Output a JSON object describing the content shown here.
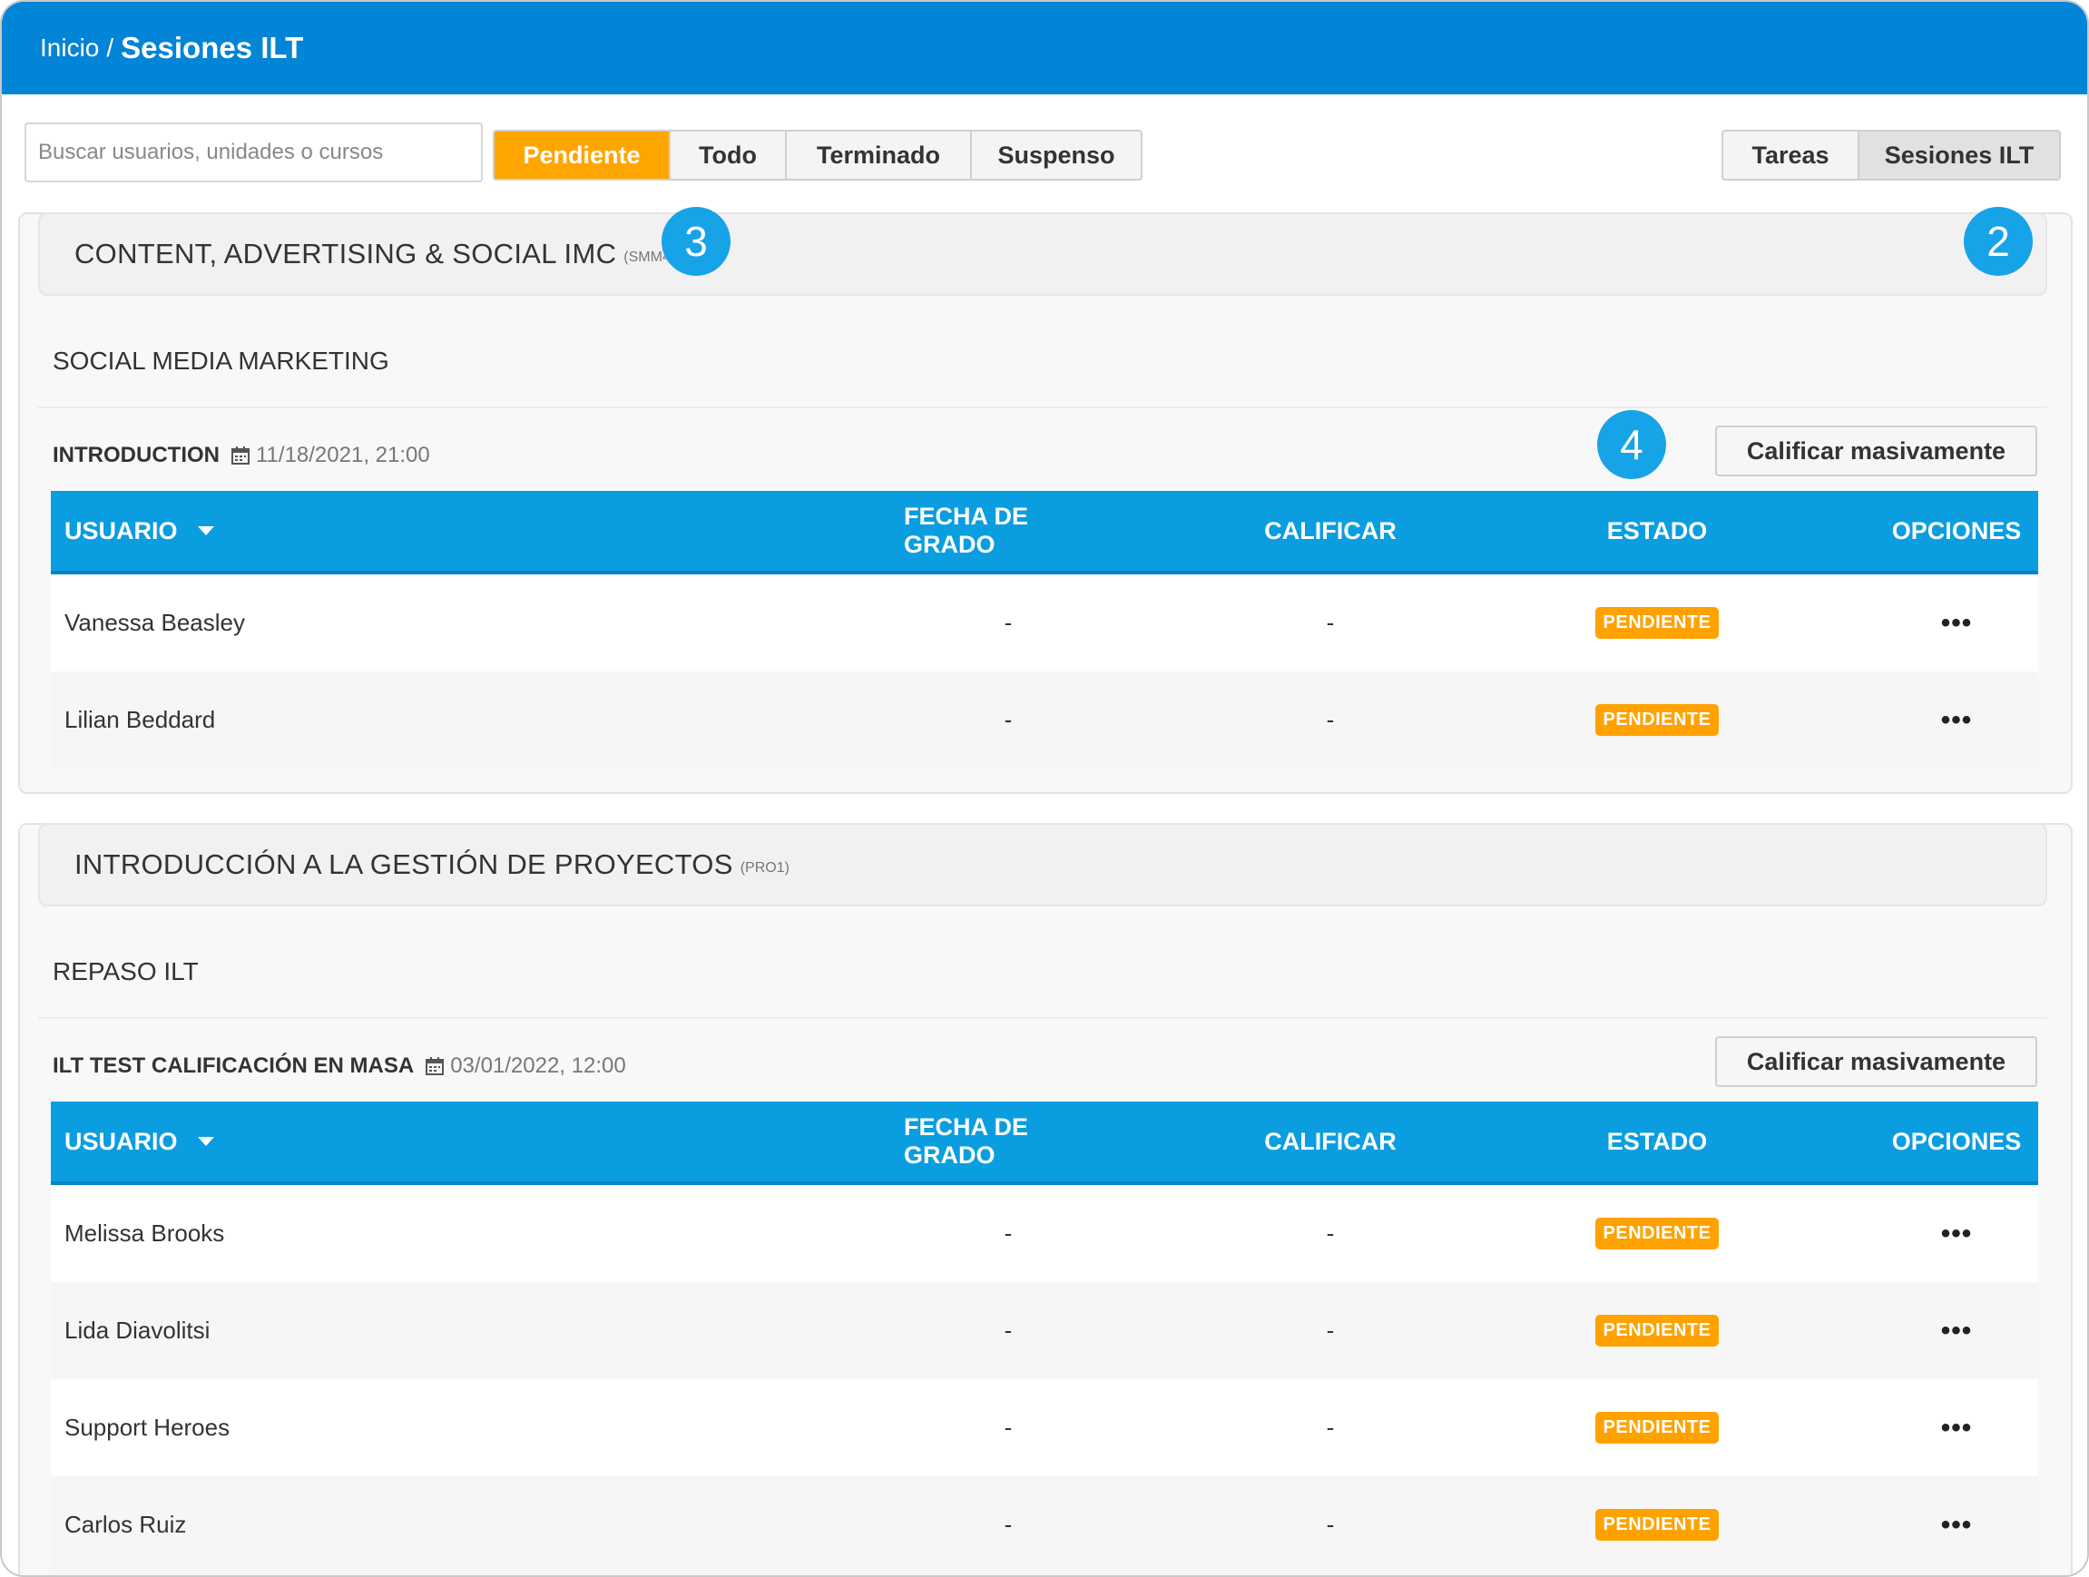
{
  "header": {
    "breadcrumb_home": "Inicio",
    "breadcrumb_separator": "/",
    "breadcrumb_current": "Sesiones ILT"
  },
  "search": {
    "placeholder": "Buscar usuarios, unidades o cursos",
    "value": ""
  },
  "status_filter": {
    "selected": "Pendiente",
    "options": [
      "Pendiente",
      "Todo",
      "Terminado",
      "Suspenso"
    ]
  },
  "view_toggle": {
    "selected": "Sesiones ILT",
    "options": [
      "Tareas",
      "Sesiones ILT"
    ]
  },
  "callouts": {
    "c2": "2",
    "c3": "3",
    "c4": "4"
  },
  "table_headers": {
    "user": "USUARIO",
    "grade_date": "FECHA DE GRADO",
    "grade": "CALIFICAR",
    "status": "ESTADO",
    "options": "OPCIONES"
  },
  "courses": [
    {
      "title": "CONTENT, ADVERTISING & SOCIAL IMC",
      "code": "(SMM4)",
      "module": "SOCIAL MEDIA MARKETING",
      "session_name": "INTRODUCTION",
      "session_date": "11/18/2021, 21:00",
      "mass_grade_label": "Calificar masivamente",
      "rows": [
        {
          "user": "Vanessa Beasley",
          "grade_date": "-",
          "grade": "-",
          "status": "PENDIENTE",
          "options": "•••"
        },
        {
          "user": "Lilian Beddard",
          "grade_date": "-",
          "grade": "-",
          "status": "PENDIENTE",
          "options": "•••"
        }
      ]
    },
    {
      "title": "INTRODUCCIÓN A LA GESTIÓN DE PROYECTOS",
      "code": "(PRO1)",
      "module": "REPASO ILT",
      "session_name": "ILT TEST CALIFICACIÓN EN MASA",
      "session_date": "03/01/2022, 12:00",
      "mass_grade_label": "Calificar masivamente",
      "rows": [
        {
          "user": "Melissa Brooks",
          "grade_date": "-",
          "grade": "-",
          "status": "PENDIENTE",
          "options": "•••"
        },
        {
          "user": "Lida Diavolitsi",
          "grade_date": "-",
          "grade": "-",
          "status": "PENDIENTE",
          "options": "•••"
        },
        {
          "user": "Support Heroes",
          "grade_date": "-",
          "grade": "-",
          "status": "PENDIENTE",
          "options": "•••"
        },
        {
          "user": "Carlos Ruiz",
          "grade_date": "-",
          "grade": "-",
          "status": "PENDIENTE",
          "options": "•••"
        }
      ]
    }
  ],
  "colors": {
    "header_blue": "#0284d7",
    "table_header_blue": "#0a9ee0",
    "active_filter_orange": "#ffa500",
    "status_badge_orange": "#ffa200",
    "callout_blue": "#17a3e8"
  }
}
